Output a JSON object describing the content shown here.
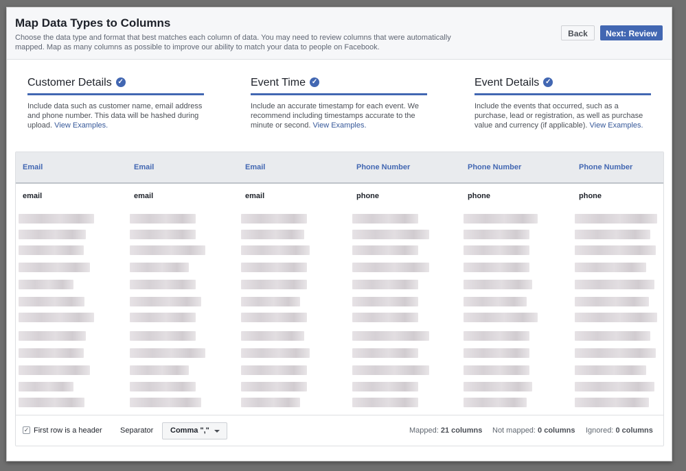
{
  "header": {
    "title": "Map Data Types to Columns",
    "subtitle": "Choose the data type and format that best matches each column of data. You may need to review columns that were automatically mapped. Map as many columns as possible to improve our ability to match your data to people on Facebook.",
    "back_label": "Back",
    "next_label": "Next: Review"
  },
  "steps": [
    {
      "title": "Customer Details",
      "desc": "Include data such as customer name, email address and phone number. This data will be hashed during upload.",
      "link": "View Examples."
    },
    {
      "title": "Event Time",
      "desc": "Include an accurate timestamp for each event. We recommend including timestamps accurate to the minute or second.",
      "link": "View Examples."
    },
    {
      "title": "Event Details",
      "desc": "Include the events that occurred, such as a purchase, lead or registration, as well as purchase value and currency (if applicable).",
      "link": "View Examples."
    }
  ],
  "table": {
    "columns": [
      "Email",
      "Email",
      "Email",
      "Phone Number",
      "Phone Number",
      "Phone Number"
    ],
    "first_row": [
      "email",
      "email",
      "email",
      "phone",
      "phone",
      "phone"
    ]
  },
  "footer": {
    "first_row_header_label": "First row is a header",
    "first_row_header_checked": true,
    "separator_label": "Separator",
    "separator_value": "Comma \",\"",
    "mapped_label": "Mapped:",
    "mapped_value": "21 columns",
    "not_mapped_label": "Not mapped:",
    "not_mapped_value": "0 columns",
    "ignored_label": "Ignored:",
    "ignored_value": "0 columns"
  },
  "colors": {
    "accent": "#4267b2",
    "link": "#365899"
  }
}
